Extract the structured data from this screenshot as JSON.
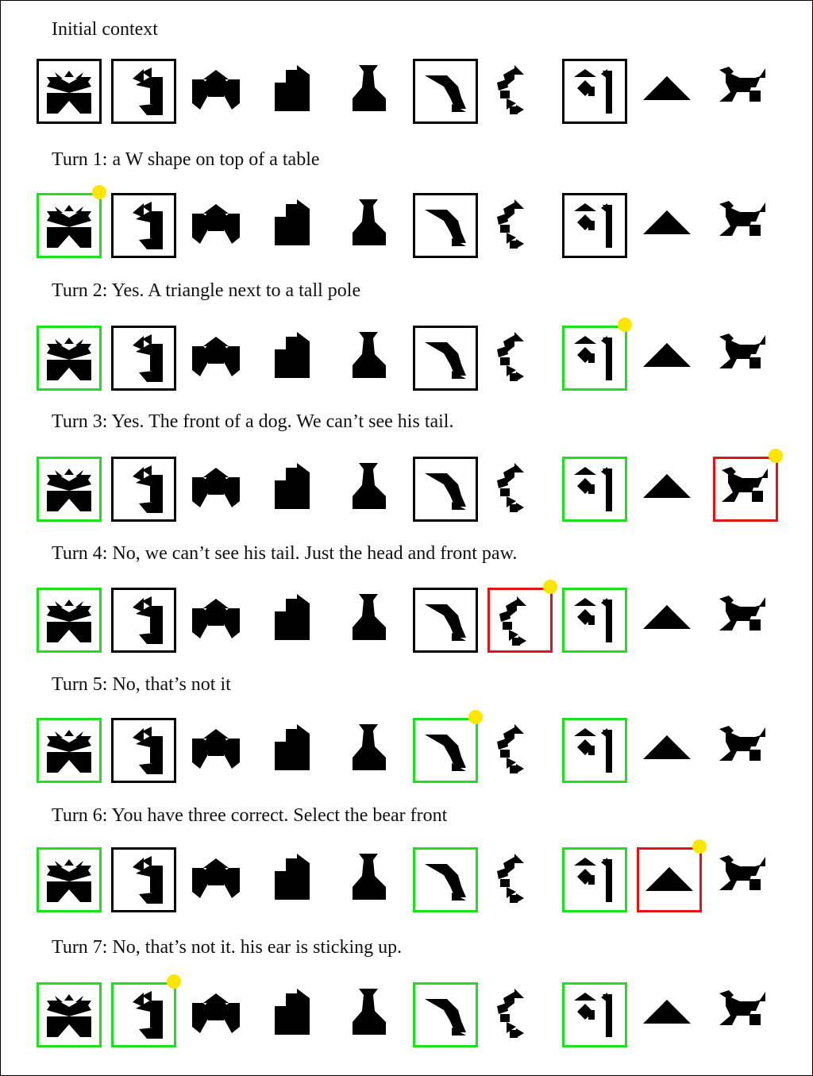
{
  "colors": {
    "selected_correct": "#1fe01f",
    "selected_wrong": "#e01515",
    "boxed": "#000000",
    "marker": "#ffe600"
  },
  "shape_names": [
    "w-table",
    "side-figure",
    "bowtie-house",
    "block-stack",
    "vase",
    "bird-angle",
    "bent-chain",
    "triangle-pole",
    "bear-front",
    "dog"
  ],
  "sections": [
    {
      "label": "Initial context",
      "tiles": [
        "black",
        "black",
        "none",
        "none",
        "none",
        "black",
        "none",
        "black",
        "none",
        "none"
      ],
      "marker": null
    },
    {
      "label": "Turn 1: a W shape on top of a table",
      "tiles": [
        "green",
        "black",
        "none",
        "none",
        "none",
        "black",
        "none",
        "black",
        "none",
        "none"
      ],
      "marker": 0
    },
    {
      "label": "Turn 2: Yes. A triangle next to a tall pole",
      "tiles": [
        "green",
        "black",
        "none",
        "none",
        "none",
        "black",
        "none",
        "green",
        "none",
        "none"
      ],
      "marker": 7
    },
    {
      "label": "Turn 3: Yes. The front of a dog. We can’t see his tail.",
      "tiles": [
        "green",
        "black",
        "none",
        "none",
        "none",
        "black",
        "none",
        "green",
        "none",
        "red"
      ],
      "marker": 9
    },
    {
      "label": "Turn 4: No, we can’t see his tail. Just the head and front paw.",
      "tiles": [
        "green",
        "black",
        "none",
        "none",
        "none",
        "black",
        "red",
        "green",
        "none",
        "none"
      ],
      "marker": 6
    },
    {
      "label": "Turn 5: No, that’s not it",
      "tiles": [
        "green",
        "black",
        "none",
        "none",
        "none",
        "green",
        "none",
        "green",
        "none",
        "none"
      ],
      "marker": 5
    },
    {
      "label": "Turn 6: You have three correct. Select the bear front",
      "tiles": [
        "green",
        "black",
        "none",
        "none",
        "none",
        "green",
        "none",
        "green",
        "red",
        "none"
      ],
      "marker": 8
    },
    {
      "label": "Turn 7: No, that’s not it. his ear is sticking up.",
      "tiles": [
        "green",
        "green",
        "none",
        "none",
        "none",
        "green",
        "none",
        "green",
        "none",
        "none"
      ],
      "marker": 1
    }
  ]
}
